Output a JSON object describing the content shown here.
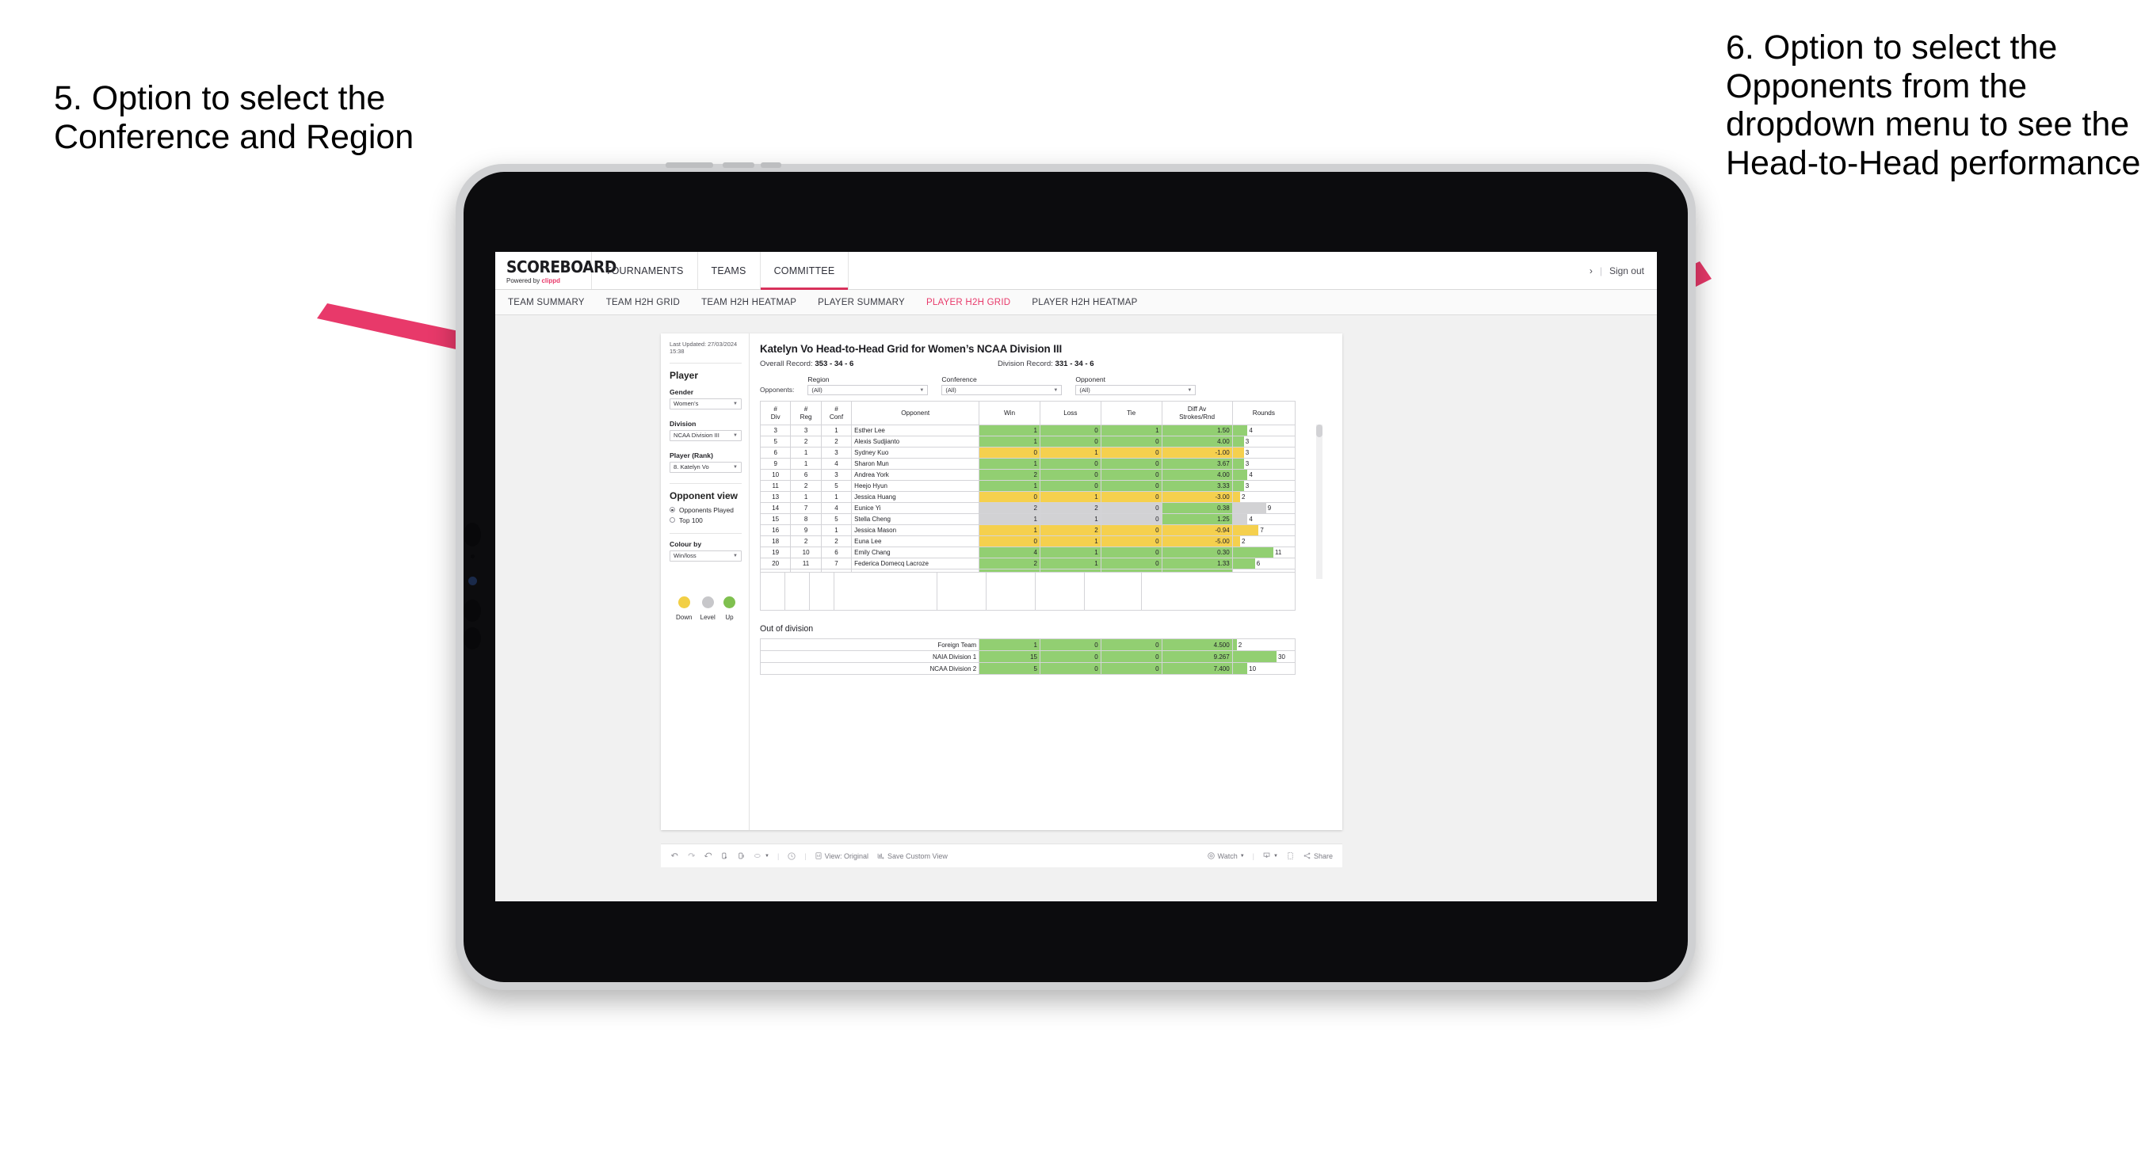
{
  "annotations": {
    "left": "5. Option to select the Conference and Region",
    "right": "6. Option to select the Opponents from the dropdown menu to see the Head-to-Head performance",
    "arrow_color": "#e8396a"
  },
  "app": {
    "brand": {
      "name": "SCOREBOARD",
      "powered_prefix": "Powered by ",
      "powered_brand": "clippd"
    },
    "top_nav": [
      {
        "label": "TOURNAMENTS",
        "active": false
      },
      {
        "label": "TEAMS",
        "active": false
      },
      {
        "label": "COMMITTEE",
        "active": true
      }
    ],
    "top_right": {
      "chevron": "›",
      "separator": "|",
      "sign_out": "Sign out"
    },
    "sub_nav": [
      {
        "label": "TEAM SUMMARY",
        "active": false
      },
      {
        "label": "TEAM H2H GRID",
        "active": false
      },
      {
        "label": "TEAM H2H HEATMAP",
        "active": false
      },
      {
        "label": "PLAYER SUMMARY",
        "active": false
      },
      {
        "label": "PLAYER H2H GRID",
        "active": true
      },
      {
        "label": "PLAYER H2H HEATMAP",
        "active": false
      }
    ]
  },
  "sidebar": {
    "last_updated": "Last Updated: 27/03/2024 15:38",
    "player_heading": "Player",
    "filters": [
      {
        "label": "Gender",
        "value": "Women’s"
      },
      {
        "label": "Division",
        "value": "NCAA Division III"
      },
      {
        "label": "Player (Rank)",
        "value": "8. Katelyn Vo"
      }
    ],
    "opponent_view": {
      "heading": "Opponent view",
      "options": [
        {
          "label": "Opponents Played",
          "selected": true
        },
        {
          "label": "Top 100",
          "selected": false
        }
      ]
    },
    "colour_by": {
      "label": "Colour by",
      "value": "Win/loss"
    },
    "legend": [
      {
        "label": "Down",
        "color": "#f2cf45"
      },
      {
        "label": "Level",
        "color": "#c7c7ca"
      },
      {
        "label": "Up",
        "color": "#7fc04f"
      }
    ]
  },
  "view": {
    "title": "Katelyn Vo Head-to-Head Grid for Women’s NCAA Division III",
    "overall_record_label": "Overall Record: ",
    "overall_record_value": "353 - 34 - 6",
    "division_record_label": "Division Record: ",
    "division_record_value": "331 -  34 - 6",
    "filter_bar": {
      "lead": "Opponents:",
      "selects": [
        {
          "label": "Region",
          "value": "(All)"
        },
        {
          "label": "Conference",
          "value": "(All)"
        },
        {
          "label": "Opponent",
          "value": "(All)"
        }
      ]
    },
    "out_of_division_heading": "Out of division"
  },
  "chart_data": {
    "type": "table",
    "title": "Katelyn Vo Head-to-Head Grid for Women’s NCAA Division III",
    "columns": [
      "# Div",
      "# Reg",
      "# Conf",
      "Opponent",
      "Win",
      "Loss",
      "Tie",
      "Diff Av Strokes/Rnd",
      "Rounds"
    ],
    "column_headers_two_line": [
      {
        "l1": "#",
        "l2": "Div"
      },
      {
        "l1": "#",
        "l2": "Reg"
      },
      {
        "l1": "#",
        "l2": "Conf"
      },
      {
        "l1": "Opponent",
        "l2": ""
      },
      {
        "l1": "Win",
        "l2": ""
      },
      {
        "l1": "Loss",
        "l2": ""
      },
      {
        "l1": "Tie",
        "l2": ""
      },
      {
        "l1": "Diff Av",
        "l2": "Strokes/Rnd"
      },
      {
        "l1": "Rounds",
        "l2": ""
      }
    ],
    "rounds_max": 12,
    "rows": [
      {
        "div": "3",
        "reg": "3",
        "conf": "1",
        "opponent": "Esther Lee",
        "win": "1",
        "loss": "0",
        "tie": "1",
        "diff": "1.50",
        "rounds": "4",
        "status": "up"
      },
      {
        "div": "5",
        "reg": "2",
        "conf": "2",
        "opponent": "Alexis Sudjianto",
        "win": "1",
        "loss": "0",
        "tie": "0",
        "diff": "4.00",
        "rounds": "3",
        "status": "up"
      },
      {
        "div": "6",
        "reg": "1",
        "conf": "3",
        "opponent": "Sydney Kuo",
        "win": "0",
        "loss": "1",
        "tie": "0",
        "diff": "-1.00",
        "rounds": "3",
        "status": "down"
      },
      {
        "div": "9",
        "reg": "1",
        "conf": "4",
        "opponent": "Sharon Mun",
        "win": "1",
        "loss": "0",
        "tie": "0",
        "diff": "3.67",
        "rounds": "3",
        "status": "up"
      },
      {
        "div": "10",
        "reg": "6",
        "conf": "3",
        "opponent": "Andrea York",
        "win": "2",
        "loss": "0",
        "tie": "0",
        "diff": "4.00",
        "rounds": "4",
        "status": "up"
      },
      {
        "div": "11",
        "reg": "2",
        "conf": "5",
        "opponent": "Heejo Hyun",
        "win": "1",
        "loss": "0",
        "tie": "0",
        "diff": "3.33",
        "rounds": "3",
        "status": "up"
      },
      {
        "div": "13",
        "reg": "1",
        "conf": "1",
        "opponent": "Jessica Huang",
        "win": "0",
        "loss": "1",
        "tie": "0",
        "diff": "-3.00",
        "rounds": "2",
        "status": "down"
      },
      {
        "div": "14",
        "reg": "7",
        "conf": "4",
        "opponent": "Eunice Yi",
        "win": "2",
        "loss": "2",
        "tie": "0",
        "diff": "0.38",
        "rounds": "9",
        "status": "level",
        "diff_status": "up"
      },
      {
        "div": "15",
        "reg": "8",
        "conf": "5",
        "opponent": "Stella Cheng",
        "win": "1",
        "loss": "1",
        "tie": "0",
        "diff": "1.25",
        "rounds": "4",
        "status": "level",
        "diff_status": "up"
      },
      {
        "div": "16",
        "reg": "9",
        "conf": "1",
        "opponent": "Jessica Mason",
        "win": "1",
        "loss": "2",
        "tie": "0",
        "diff": "-0.94",
        "rounds": "7",
        "status": "down"
      },
      {
        "div": "18",
        "reg": "2",
        "conf": "2",
        "opponent": "Euna Lee",
        "win": "0",
        "loss": "1",
        "tie": "0",
        "diff": "-5.00",
        "rounds": "2",
        "status": "down"
      },
      {
        "div": "19",
        "reg": "10",
        "conf": "6",
        "opponent": "Emily Chang",
        "win": "4",
        "loss": "1",
        "tie": "0",
        "diff": "0.30",
        "rounds": "11",
        "status": "up"
      },
      {
        "div": "20",
        "reg": "11",
        "conf": "7",
        "opponent": "Federica Domecq Lacroze",
        "win": "2",
        "loss": "1",
        "tie": "0",
        "diff": "1.33",
        "rounds": "6",
        "status": "up"
      }
    ],
    "out_of_division": {
      "heading": "Out of division",
      "rounds_max": 32,
      "rows": [
        {
          "name": "Foreign Team",
          "win": "1",
          "loss": "0",
          "tie": "0",
          "diff": "4.500",
          "rounds": "2",
          "status": "up"
        },
        {
          "name": "NAIA Division 1",
          "win": "15",
          "loss": "0",
          "tie": "0",
          "diff": "9.267",
          "rounds": "30",
          "status": "up"
        },
        {
          "name": "NCAA Division 2",
          "win": "5",
          "loss": "0",
          "tie": "0",
          "diff": "7.400",
          "rounds": "10",
          "status": "up"
        }
      ]
    }
  },
  "toolbar": {
    "items": [
      {
        "name": "undo-icon",
        "label": ""
      },
      {
        "name": "redo-icon",
        "label": ""
      },
      {
        "name": "revert-icon",
        "label": ""
      },
      {
        "name": "refresh-icon",
        "label": ""
      },
      {
        "name": "pause-icon",
        "label": ""
      },
      {
        "name": "highlight-icon",
        "label": ""
      },
      {
        "name": "clock-icon",
        "label": ""
      },
      {
        "name": "view-original",
        "label": "View: Original"
      },
      {
        "name": "save-custom-view",
        "label": "Save Custom View"
      },
      {
        "name": "watch",
        "label": "Watch"
      },
      {
        "name": "download-icon",
        "label": ""
      },
      {
        "name": "fullscreen-icon",
        "label": ""
      },
      {
        "name": "share",
        "label": "Share"
      }
    ],
    "view_original": "View: Original",
    "save_custom_view": "Save Custom View",
    "watch": "Watch",
    "share": "Share"
  }
}
